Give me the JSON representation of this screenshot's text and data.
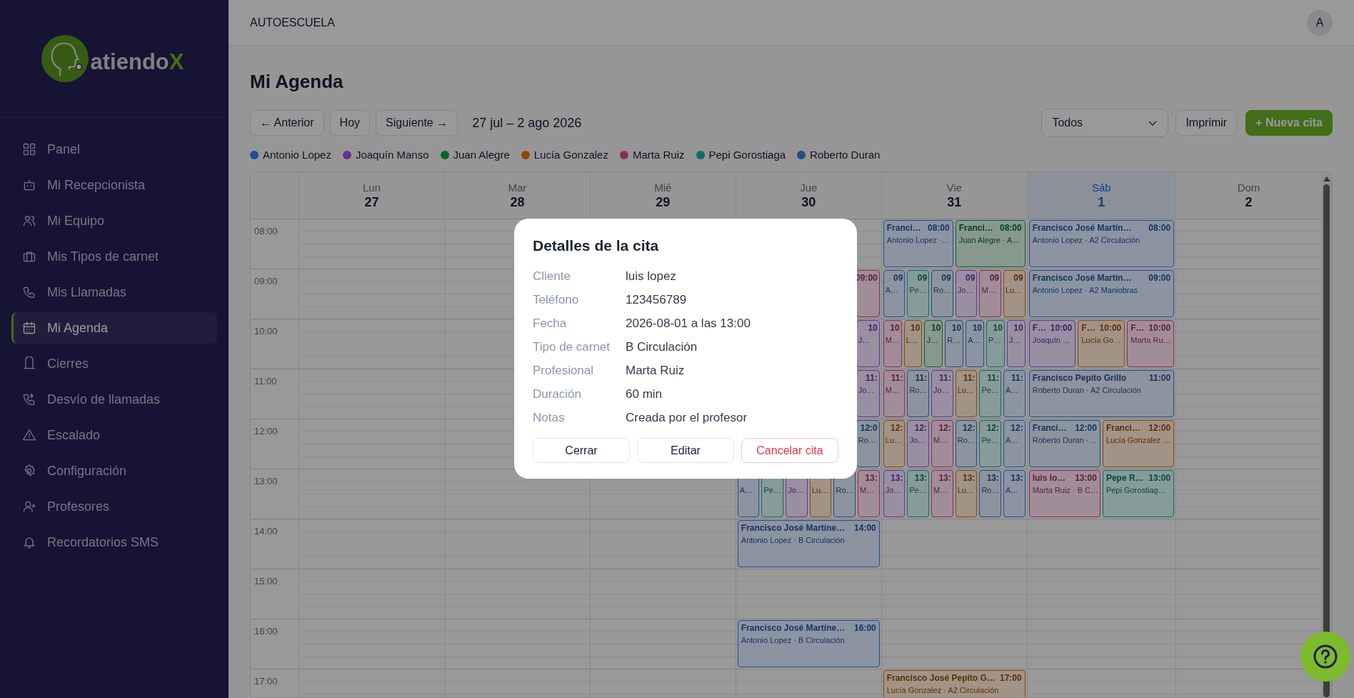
{
  "sidebar": {
    "logo": {
      "text": "atiendo",
      "accent": "X"
    },
    "items": [
      {
        "label": "Panel",
        "selected": false
      },
      {
        "label": "Mi Recepcionista",
        "selected": false
      },
      {
        "label": "Mi Equipo",
        "selected": false
      },
      {
        "label": "Mis Tipos de carnet",
        "selected": false
      },
      {
        "label": "Mis Llamadas",
        "selected": false
      },
      {
        "label": "Mi Agenda",
        "selected": true
      },
      {
        "label": "Cierres",
        "selected": false
      },
      {
        "label": "Desvío de llamadas",
        "selected": false
      },
      {
        "label": "Escalado",
        "selected": false
      },
      {
        "label": "Configuración",
        "selected": false
      },
      {
        "label": "Profesores",
        "selected": false
      },
      {
        "label": "Recordatorios SMS",
        "selected": false
      }
    ]
  },
  "header": {
    "title": "AUTOESCUELA",
    "avatar": "A"
  },
  "page_title": "Mi Agenda",
  "toolbar": {
    "prev": "← Anterior",
    "today": "Hoy",
    "next": "Siguiente →",
    "range": "27 jul – 2 ago 2026",
    "filter": "Todos",
    "print": "Imprimir",
    "new": "+ Nueva cita"
  },
  "legend": [
    {
      "name": "Antonio Lopez",
      "color": "#234e94"
    },
    {
      "name": "Joaquín Manso",
      "color": "#653394"
    },
    {
      "name": "Juan Alegre",
      "color": "#0d622c"
    },
    {
      "name": "Lucía Gonzalez",
      "color": "#8c4907"
    },
    {
      "name": "Marta Ruiz",
      "color": "#8e2b5c"
    },
    {
      "name": "Pepi Gorostiaga",
      "color": "#0c6e64"
    },
    {
      "name": "Roberto Duran",
      "color": "#234b82"
    }
  ],
  "calendar": {
    "hours": [
      "08:00",
      "09:00",
      "10:00",
      "11:00",
      "12:00",
      "13:00",
      "14:00",
      "15:00",
      "16:00",
      "17:00"
    ],
    "days": [
      {
        "label": "Lun",
        "date": "27",
        "today": false
      },
      {
        "label": "Mar",
        "date": "28",
        "today": false
      },
      {
        "label": "Mié",
        "date": "29",
        "today": false
      },
      {
        "label": "Jue",
        "date": "30",
        "today": false,
        "rows": [
          {},
          {
            "events": [
              {
                "time": "09:00",
                "color": "#8e2b5c"
              }
            ]
          },
          {
            "events": [
              {
                "time": "10",
                "sub": "J…",
                "color": "#653394"
              }
            ]
          },
          {
            "events": [
              {
                "time": "11:",
                "sub": "Jo…",
                "color": "#653394"
              }
            ]
          },
          {
            "events": [
              {
                "time": "12:0",
                "sub": "Ro…",
                "color": "#234b82"
              }
            ]
          },
          {
            "events": [
              {
                "sub": "A…",
                "color": "#234e94"
              },
              {
                "sub": "Pe…",
                "color": "#0c6e64"
              },
              {
                "sub": "Jo…",
                "color": "#653394"
              },
              {
                "sub": "Lu…",
                "color": "#8c4907"
              },
              {
                "sub": "Ro…",
                "color": "#234b82"
              },
              {
                "time": "13:",
                "sub": "M…",
                "color": "#8e2b5c"
              }
            ]
          },
          {
            "events": [
              {
                "title": "Francisco José Martíne…",
                "time": "14:00",
                "sub": "Antonio Lopez · B Circulación",
                "color": "#234e94"
              }
            ]
          },
          {},
          {
            "events": [
              {
                "title": "Francisco José Martíne…",
                "time": "16:00",
                "sub": "Antonio Lopez · B Circulación",
                "color": "#234e94"
              }
            ]
          }
        ]
      },
      {
        "label": "Vie",
        "date": "31",
        "today": false,
        "rows": [
          {
            "events": [
              {
                "title": "Franci…",
                "time": "08:00",
                "sub": "Antonio Lopez ·…",
                "color": "#234e94"
              },
              {
                "title": "Franci…",
                "time": "08:00",
                "sub": "Juan Alegre · A…",
                "color": "#0d622c"
              }
            ]
          },
          {
            "events": [
              {
                "time": "09",
                "sub": "A…",
                "color": "#234e94"
              },
              {
                "time": "09",
                "sub": "Pe…",
                "color": "#0c6e64"
              },
              {
                "time": "09",
                "sub": "Ro…",
                "color": "#234b82"
              },
              {
                "time": "09",
                "sub": "Jo…",
                "color": "#653394"
              },
              {
                "time": "09",
                "sub": "M…",
                "color": "#8e2b5c"
              },
              {
                "time": "09",
                "sub": "Lu…",
                "color": "#8c4907"
              }
            ]
          },
          {
            "events": [
              {
                "time": "10",
                "sub": "M…",
                "color": "#8e2b5c"
              },
              {
                "time": "10",
                "sub": "L…",
                "color": "#8c4907"
              },
              {
                "time": "10",
                "sub": "J…",
                "color": "#0d622c"
              },
              {
                "time": "10",
                "sub": "R…",
                "color": "#234b82"
              },
              {
                "time": "10",
                "sub": "A…",
                "color": "#234e94"
              },
              {
                "time": "10",
                "sub": "P…",
                "color": "#0c6e64"
              },
              {
                "time": "10",
                "sub": "J…",
                "color": "#653394"
              }
            ]
          },
          {
            "events": [
              {
                "time": "11:",
                "sub": "M…",
                "color": "#8e2b5c"
              },
              {
                "time": "11:",
                "sub": "Ro…",
                "color": "#234b82"
              },
              {
                "time": "11:",
                "sub": "Jo…",
                "color": "#653394"
              },
              {
                "time": "11:",
                "sub": "Lu…",
                "color": "#8c4907"
              },
              {
                "time": "11:",
                "sub": "Pe…",
                "color": "#0c6e64"
              },
              {
                "time": "11:",
                "sub": "A…",
                "color": "#234e94"
              }
            ]
          },
          {
            "events": [
              {
                "time": "12:",
                "sub": "Lu…",
                "color": "#8c4907"
              },
              {
                "time": "12:",
                "sub": "Jo…",
                "color": "#653394"
              },
              {
                "time": "12:",
                "sub": "M…",
                "color": "#8e2b5c"
              },
              {
                "time": "12:",
                "sub": "Ro…",
                "color": "#234b82"
              },
              {
                "time": "12:",
                "sub": "Pe…",
                "color": "#0c6e64"
              },
              {
                "time": "12:",
                "sub": "A…",
                "color": "#234e94"
              }
            ]
          },
          {
            "events": [
              {
                "time": "13:",
                "sub": "Jo…",
                "color": "#653394"
              },
              {
                "time": "13:",
                "sub": "Pe…",
                "color": "#0c6e64"
              },
              {
                "time": "13:",
                "sub": "M…",
                "color": "#8e2b5c"
              },
              {
                "time": "13:",
                "sub": "Lu…",
                "color": "#8c4907"
              },
              {
                "time": "13:",
                "sub": "Ro…",
                "color": "#234b82"
              },
              {
                "time": "13:",
                "sub": "A…",
                "color": "#234e94"
              }
            ]
          },
          {},
          {},
          {},
          {
            "events": [
              {
                "title": "Francisco José Pepito G…",
                "time": "17:00",
                "sub": "Lucía Gonzalez · A2 Circulación",
                "color": "#8c4907"
              }
            ]
          }
        ]
      },
      {
        "label": "Sáb",
        "date": "1",
        "today": true,
        "rows": [
          {
            "events": [
              {
                "title": "Francisco José Martín…",
                "time": "08:00",
                "sub": "Antonio Lopez · A2 Circulación",
                "color": "#234e94"
              }
            ]
          },
          {
            "events": [
              {
                "title": "Francisco José Martín…",
                "time": "09:00",
                "sub": "Antonio Lopez · A2 Maniobras",
                "color": "#234e94"
              }
            ]
          },
          {
            "events": [
              {
                "title": "F…",
                "time": "10:00",
                "sub": "Joaquín …",
                "color": "#653394"
              },
              {
                "title": "F…",
                "time": "10:00",
                "sub": "Lucía Go…",
                "color": "#8c4907"
              },
              {
                "title": "F…",
                "time": "10:00",
                "sub": "Marta Ru…",
                "color": "#8e2b5c"
              }
            ]
          },
          {
            "events": [
              {
                "title": "Francisco Pepito Grillo",
                "time": "11:00",
                "sub": "Roberto Duran · A2 Circulación",
                "color": "#234b82"
              }
            ]
          },
          {
            "events": [
              {
                "title": "Franci…",
                "time": "12:00",
                "sub": "Roberto Duran ·…",
                "color": "#234b82"
              },
              {
                "title": "Franci…",
                "time": "12:00",
                "sub": "Lucía Gonzalez …",
                "color": "#8c4907"
              }
            ]
          },
          {
            "events": [
              {
                "title": "luis lo…",
                "time": "13:00",
                "sub": "Marta Ruiz · B C…",
                "color": "#8e2b5c"
              },
              {
                "title": "Pepe R…",
                "time": "13:00",
                "sub": "Pepi Gorostiag…",
                "color": "#0c6e64"
              }
            ]
          }
        ]
      },
      {
        "label": "Dom",
        "date": "2",
        "today": false
      }
    ]
  },
  "modal": {
    "title": "Detalles de la cita",
    "fields": [
      {
        "label": "Cliente",
        "value": "luis lopez"
      },
      {
        "label": "Teléfono",
        "value": "123456789"
      },
      {
        "label": "Fecha",
        "value": "2026-08-01 a las 13:00"
      },
      {
        "label": "Tipo de carnet",
        "value": "B Circulación"
      },
      {
        "label": "Profesional",
        "value": "Marta Ruiz"
      },
      {
        "label": "Duración",
        "value": "60 min"
      },
      {
        "label": "Notas",
        "value": "Creada por el profesor"
      }
    ],
    "buttons": [
      {
        "label": "Cerrar",
        "kind": "plain"
      },
      {
        "label": "Editar",
        "kind": "plain"
      },
      {
        "label": "Cancelar cita",
        "kind": "danger"
      }
    ]
  }
}
